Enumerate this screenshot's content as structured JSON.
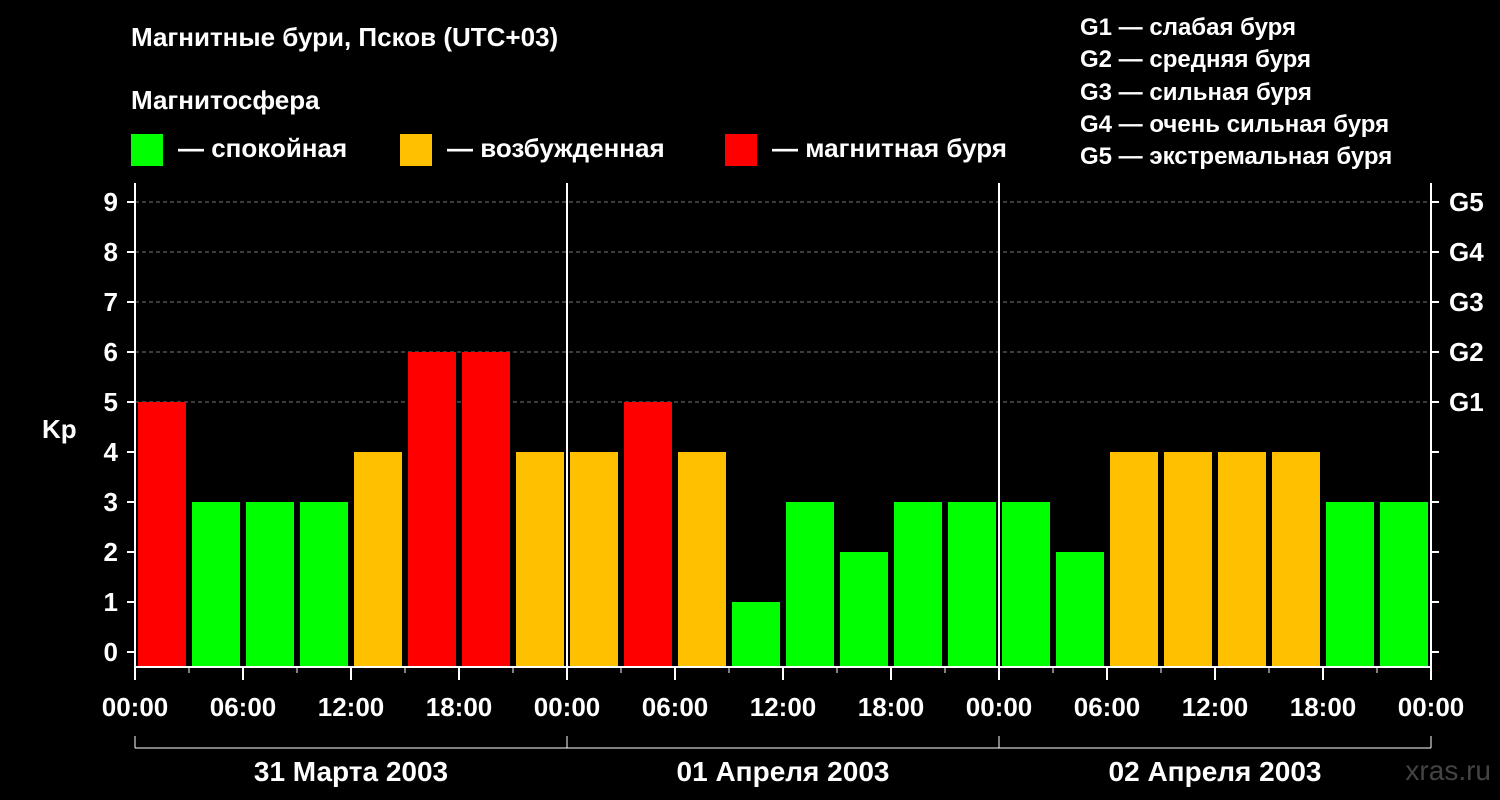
{
  "title": "Магнитные бури, Псков (UTC+03)",
  "legend": {
    "heading": "Магнитосфера",
    "items": [
      {
        "label": "— спокойная",
        "color": "#00ff00"
      },
      {
        "label": "— возбужденная",
        "color": "#ffc000"
      },
      {
        "label": "— магнитная буря",
        "color": "#ff0000"
      }
    ]
  },
  "storm_scale": [
    "G1 — слабая буря",
    "G2 — средняя буря",
    "G3 — сильная буря",
    "G4 — очень сильная буря",
    "G5 — экстремальная буря"
  ],
  "watermark": "xras.ru",
  "chart_data": {
    "type": "bar",
    "title": "Магнитные бури, Псков (UTC+03)",
    "ylabel": "Kp",
    "ylim": [
      0,
      9
    ],
    "yticks": [
      "0",
      "1",
      "2",
      "3",
      "4",
      "5",
      "6",
      "7",
      "8",
      "9"
    ],
    "right_ticks": [
      {
        "value": 5,
        "label": "G1"
      },
      {
        "value": 6,
        "label": "G2"
      },
      {
        "value": 7,
        "label": "G3"
      },
      {
        "value": 8,
        "label": "G4"
      },
      {
        "value": 9,
        "label": "G5"
      }
    ],
    "xtick_labels": [
      "00:00",
      "06:00",
      "12:00",
      "18:00",
      "00:00",
      "06:00",
      "12:00",
      "18:00",
      "00:00",
      "06:00",
      "12:00",
      "18:00",
      "00:00"
    ],
    "days": [
      "31 Марта 2003",
      "01 Апреля 2003",
      "02 Апреля 2003"
    ],
    "grid": true,
    "values": [
      5,
      3,
      3,
      3,
      4,
      6,
      6,
      4,
      4,
      5,
      4,
      1,
      3,
      2,
      3,
      3,
      3,
      2,
      4,
      4,
      4,
      4,
      3,
      3
    ],
    "colors": {
      "quiet": "#00ff00",
      "active": "#ffc000",
      "storm": "#ff0000"
    }
  }
}
